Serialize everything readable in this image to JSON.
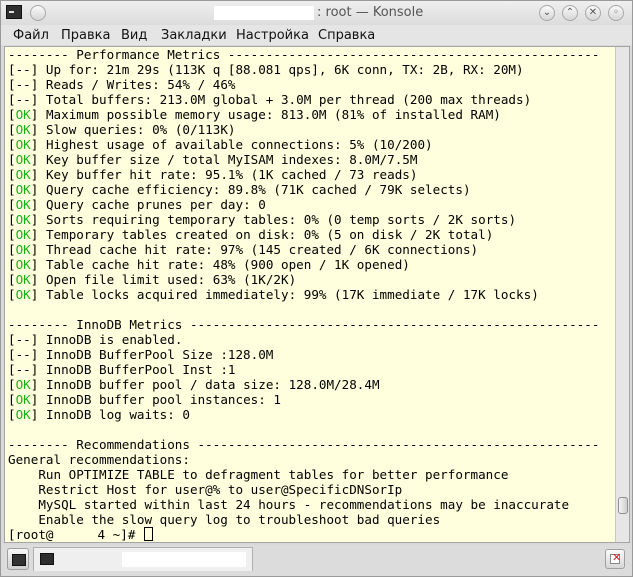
{
  "window": {
    "title": ": root — Konsole",
    "icon": "terminal-icon"
  },
  "menubar": {
    "items": [
      "Файл",
      "Правка",
      "Вид",
      "Закладки",
      "Настройка",
      "Справка"
    ]
  },
  "terminal": {
    "lines": [
      {
        "text": "-------- Performance Metrics -------------------------------------------------"
      },
      {
        "tag": "[--]",
        "text": " Up for: 21m 29s (113K q [88.081 qps], 6K conn, TX: 2B, RX: 20M)"
      },
      {
        "tag": "[--]",
        "text": " Reads / Writes: 54% / 46%"
      },
      {
        "tag": "[--]",
        "text": " Total buffers: 213.0M global + 3.0M per thread (200 max threads)"
      },
      {
        "tag": "[OK]",
        "text": " Maximum possible memory usage: 813.0M (81% of installed RAM)"
      },
      {
        "tag": "[OK]",
        "text": " Slow queries: 0% (0/113K)"
      },
      {
        "tag": "[OK]",
        "text": " Highest usage of available connections: 5% (10/200)"
      },
      {
        "tag": "[OK]",
        "text": " Key buffer size / total MyISAM indexes: 8.0M/7.5M"
      },
      {
        "tag": "[OK]",
        "text": " Key buffer hit rate: 95.1% (1K cached / 73 reads)"
      },
      {
        "tag": "[OK]",
        "text": " Query cache efficiency: 89.8% (71K cached / 79K selects)"
      },
      {
        "tag": "[OK]",
        "text": " Query cache prunes per day: 0"
      },
      {
        "tag": "[OK]",
        "text": " Sorts requiring temporary tables: 0% (0 temp sorts / 2K sorts)"
      },
      {
        "tag": "[OK]",
        "text": " Temporary tables created on disk: 0% (5 on disk / 2K total)"
      },
      {
        "tag": "[OK]",
        "text": " Thread cache hit rate: 97% (145 created / 6K connections)"
      },
      {
        "tag": "[OK]",
        "text": " Table cache hit rate: 48% (900 open / 1K opened)"
      },
      {
        "tag": "[OK]",
        "text": " Open file limit used: 63% (1K/2K)"
      },
      {
        "tag": "[OK]",
        "text": " Table locks acquired immediately: 99% (17K immediate / 17K locks)"
      },
      {
        "text": ""
      },
      {
        "text": "-------- InnoDB Metrics ------------------------------------------------------"
      },
      {
        "tag": "[--]",
        "text": " InnoDB is enabled."
      },
      {
        "tag": "[--]",
        "text": " InnoDB BufferPool Size :128.0M"
      },
      {
        "tag": "[--]",
        "text": " InnoDB BufferPool Inst :1"
      },
      {
        "tag": "[OK]",
        "text": " InnoDB buffer pool / data size: 128.0M/28.4M"
      },
      {
        "tag": "[OK]",
        "text": " InnoDB buffer pool instances: 1"
      },
      {
        "tag": "[OK]",
        "text": " InnoDB log waits: 0"
      },
      {
        "text": ""
      },
      {
        "text": "-------- Recommendations -----------------------------------------------------"
      },
      {
        "text": "General recommendations:"
      },
      {
        "text": "    Run OPTIMIZE TABLE to defragment tables for better performance"
      },
      {
        "text": "    Restrict Host for user@% to user@SpecificDNSorIp"
      },
      {
        "text": "    MySQL started within last 24 hours - recommendations may be inaccurate"
      },
      {
        "text": "    Enable the slow query log to troubleshoot bad queries"
      }
    ],
    "prompt_prefix": "[root@",
    "prompt_suffix": "4 ~]# ",
    "ok_color": "#18b218",
    "background_color": "#ffffdd"
  },
  "tabbar": {
    "new_tab_icon": "new-tab-icon",
    "close_tab_icon": "close-tab-icon"
  }
}
